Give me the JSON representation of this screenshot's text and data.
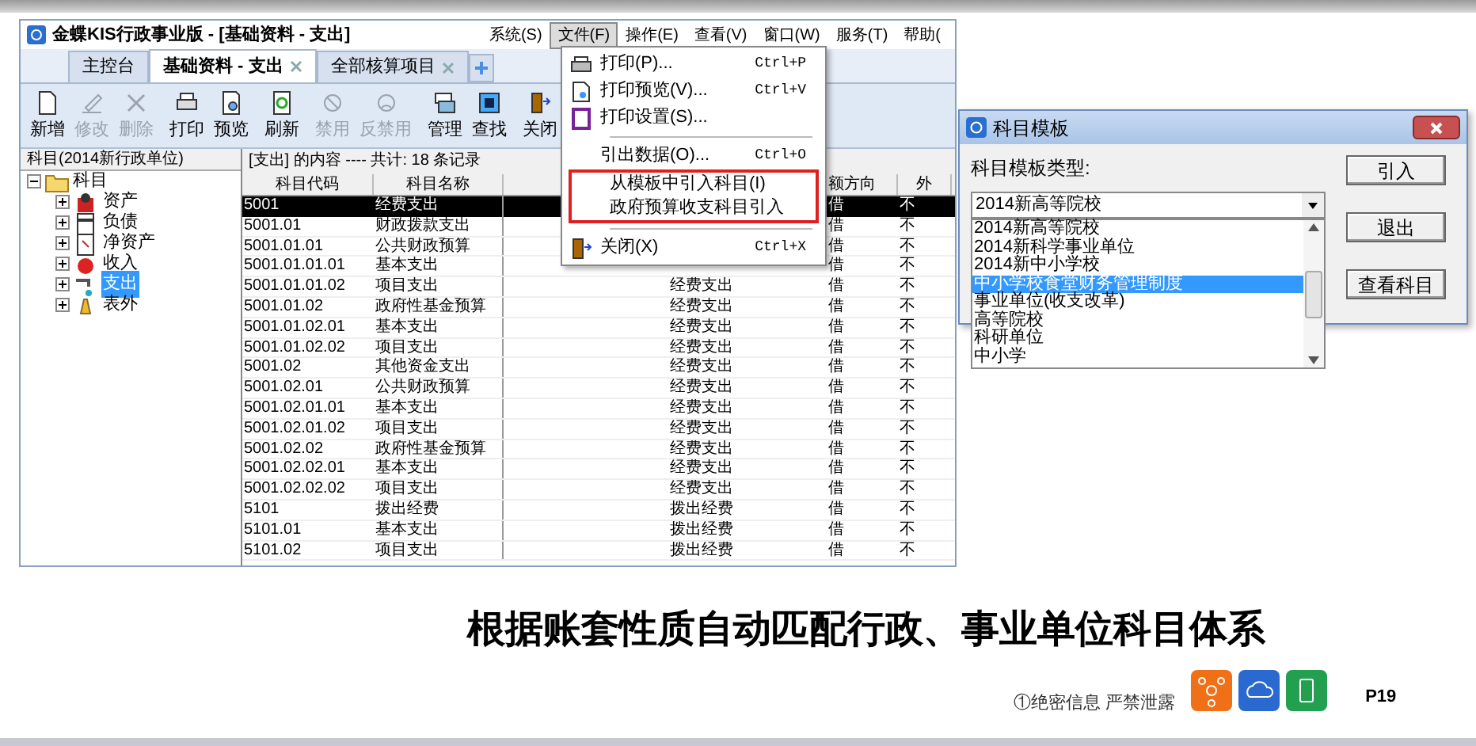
{
  "window": {
    "title": "金蝶KIS行政事业版 - [基础资料 - 支出]"
  },
  "menubar": [
    {
      "label": "系统(S)",
      "selected": false
    },
    {
      "label": "文件(F)",
      "selected": true
    },
    {
      "label": "操作(E)",
      "selected": false
    },
    {
      "label": "查看(V)",
      "selected": false
    },
    {
      "label": "窗口(W)",
      "selected": false
    },
    {
      "label": "服务(T)",
      "selected": false
    },
    {
      "label": "帮助(",
      "selected": false
    }
  ],
  "tabs": [
    {
      "label": "主控台",
      "selected": false,
      "closable": false
    },
    {
      "label": "基础资料 - 支出",
      "selected": true,
      "closable": true
    },
    {
      "label": "全部核算项目",
      "selected": false,
      "closable": true
    }
  ],
  "toolbar": [
    {
      "label": "新增",
      "disabled": false
    },
    {
      "label": "修改",
      "disabled": true
    },
    {
      "label": "删除",
      "disabled": true
    },
    {
      "label": "打印",
      "disabled": false
    },
    {
      "label": "预览",
      "disabled": false
    },
    {
      "label": "刷新",
      "disabled": false
    },
    {
      "label": "禁用",
      "disabled": true
    },
    {
      "label": "反禁用",
      "disabled": true
    },
    {
      "label": "管理",
      "disabled": false
    },
    {
      "label": "查找",
      "disabled": false
    },
    {
      "label": "关闭",
      "disabled": false
    }
  ],
  "tree": {
    "header": "科目(2014新行政单位)",
    "items": [
      {
        "label": "科目",
        "expanded": true,
        "selected": false,
        "children": [
          {
            "label": "资产",
            "expanded": false,
            "selected": false
          },
          {
            "label": "负债",
            "expanded": false,
            "selected": false
          },
          {
            "label": "净资产",
            "expanded": false,
            "selected": false
          },
          {
            "label": "收入",
            "expanded": false,
            "selected": false
          },
          {
            "label": "支出",
            "expanded": false,
            "selected": true
          },
          {
            "label": "表外",
            "expanded": false,
            "selected": false
          }
        ]
      }
    ]
  },
  "table": {
    "caption": "[支出] 的内容 ---- 共计: 18 条记录",
    "columns": [
      {
        "label": "科目代码"
      },
      {
        "label": "科目名称"
      },
      {},
      {},
      {
        "label": "额方向"
      },
      {
        "label": "外"
      }
    ],
    "rows": [
      {
        "code": "5001",
        "name": "经费支出",
        "direction": "借",
        "column_6": "不",
        "selected": true
      },
      {
        "code": "5001.01",
        "name": "财政拨款支出",
        "direction": "借",
        "column_6": "不",
        "selected": false
      },
      {
        "code": "5001.01.01",
        "name": "公共财政预算",
        "direction": "借",
        "column_6": "不",
        "selected": false
      },
      {
        "code": "5001.01.01.01",
        "name": "基本支出",
        "direction": "借",
        "column_6": "不",
        "selected": false
      },
      {
        "code": "5001.01.01.02",
        "name": "项目支出",
        "column_4": "经费支出",
        "direction": "借",
        "column_6": "不",
        "selected": false
      },
      {
        "code": "5001.01.02",
        "name": "政府性基金预算",
        "column_4": "经费支出",
        "direction": "借",
        "column_6": "不",
        "selected": false
      },
      {
        "code": "5001.01.02.01",
        "name": "基本支出",
        "column_4": "经费支出",
        "direction": "借",
        "column_6": "不",
        "selected": false
      },
      {
        "code": "5001.01.02.02",
        "name": "项目支出",
        "column_4": "经费支出",
        "direction": "借",
        "column_6": "不",
        "selected": false
      },
      {
        "code": "5001.02",
        "name": "其他资金支出",
        "column_4": "经费支出",
        "direction": "借",
        "column_6": "不",
        "selected": false
      },
      {
        "code": "5001.02.01",
        "name": "公共财政预算",
        "column_4": "经费支出",
        "direction": "借",
        "column_6": "不",
        "selected": false
      },
      {
        "code": "5001.02.01.01",
        "name": "基本支出",
        "column_4": "经费支出",
        "direction": "借",
        "column_6": "不",
        "selected": false
      },
      {
        "code": "5001.02.01.02",
        "name": "项目支出",
        "column_4": "经费支出",
        "direction": "借",
        "column_6": "不",
        "selected": false
      },
      {
        "code": "5001.02.02",
        "name": "政府性基金预算",
        "column_4": "经费支出",
        "direction": "借",
        "column_6": "不",
        "selected": false
      },
      {
        "code": "5001.02.02.01",
        "name": "基本支出",
        "column_4": "经费支出",
        "direction": "借",
        "column_6": "不",
        "selected": false
      },
      {
        "code": "5001.02.02.02",
        "name": "项目支出",
        "column_4": "经费支出",
        "direction": "借",
        "column_6": "不",
        "selected": false
      },
      {
        "code": "5101",
        "name": "拨出经费",
        "column_4": "拨出经费",
        "direction": "借",
        "column_6": "不",
        "selected": false
      },
      {
        "code": "5101.01",
        "name": "基本支出",
        "column_4": "拨出经费",
        "direction": "借",
        "column_6": "不",
        "selected": false
      },
      {
        "code": "5101.02",
        "name": "项目支出",
        "column_4": "拨出经费",
        "direction": "借",
        "column_6": "不",
        "selected": false
      }
    ]
  },
  "file_menu": [
    {
      "kind": "item",
      "label": "打印(P)...",
      "shortcut": "Ctrl+P",
      "highlighted": false
    },
    {
      "kind": "item",
      "label": "打印预览(V)...",
      "shortcut": "Ctrl+V",
      "highlighted": false
    },
    {
      "kind": "item",
      "label": "打印设置(S)...",
      "highlighted": false
    },
    {
      "kind": "separator"
    },
    {
      "kind": "item",
      "label": "引出数据(O)...",
      "shortcut": "Ctrl+O",
      "highlighted": false
    },
    {
      "kind": "item",
      "label": "从模板中引入科目(I)",
      "highlighted": true
    },
    {
      "kind": "item",
      "label": "政府预算收支科目引入",
      "highlighted": true
    },
    {
      "kind": "separator"
    },
    {
      "kind": "item",
      "label": "关闭(X)",
      "shortcut": "Ctrl+X",
      "highlighted": false
    }
  ],
  "dialog": {
    "title": "科目模板",
    "label": "科目模板类型:",
    "value": "2014新高等院校",
    "options": [
      {
        "label": "2014新高等院校",
        "highlighted": false
      },
      {
        "label": "2014新科学事业单位",
        "highlighted": false
      },
      {
        "label": "2014新中小学校",
        "highlighted": false
      },
      {
        "label": "中小学校食堂财务管理制度",
        "highlighted": true
      },
      {
        "label": "事业单位(收支改革)",
        "highlighted": false
      },
      {
        "label": "高等院校",
        "highlighted": false
      },
      {
        "label": "科研单位",
        "highlighted": false
      },
      {
        "label": "中小学",
        "highlighted": false
      }
    ],
    "buttons": [
      "引入",
      "退出",
      "查看科目"
    ]
  },
  "slide": {
    "heading": "根据账套性质自动匹配行政、事业单位科目体系",
    "footer_note": "①绝密信息 严禁泄露",
    "page": "P19"
  }
}
